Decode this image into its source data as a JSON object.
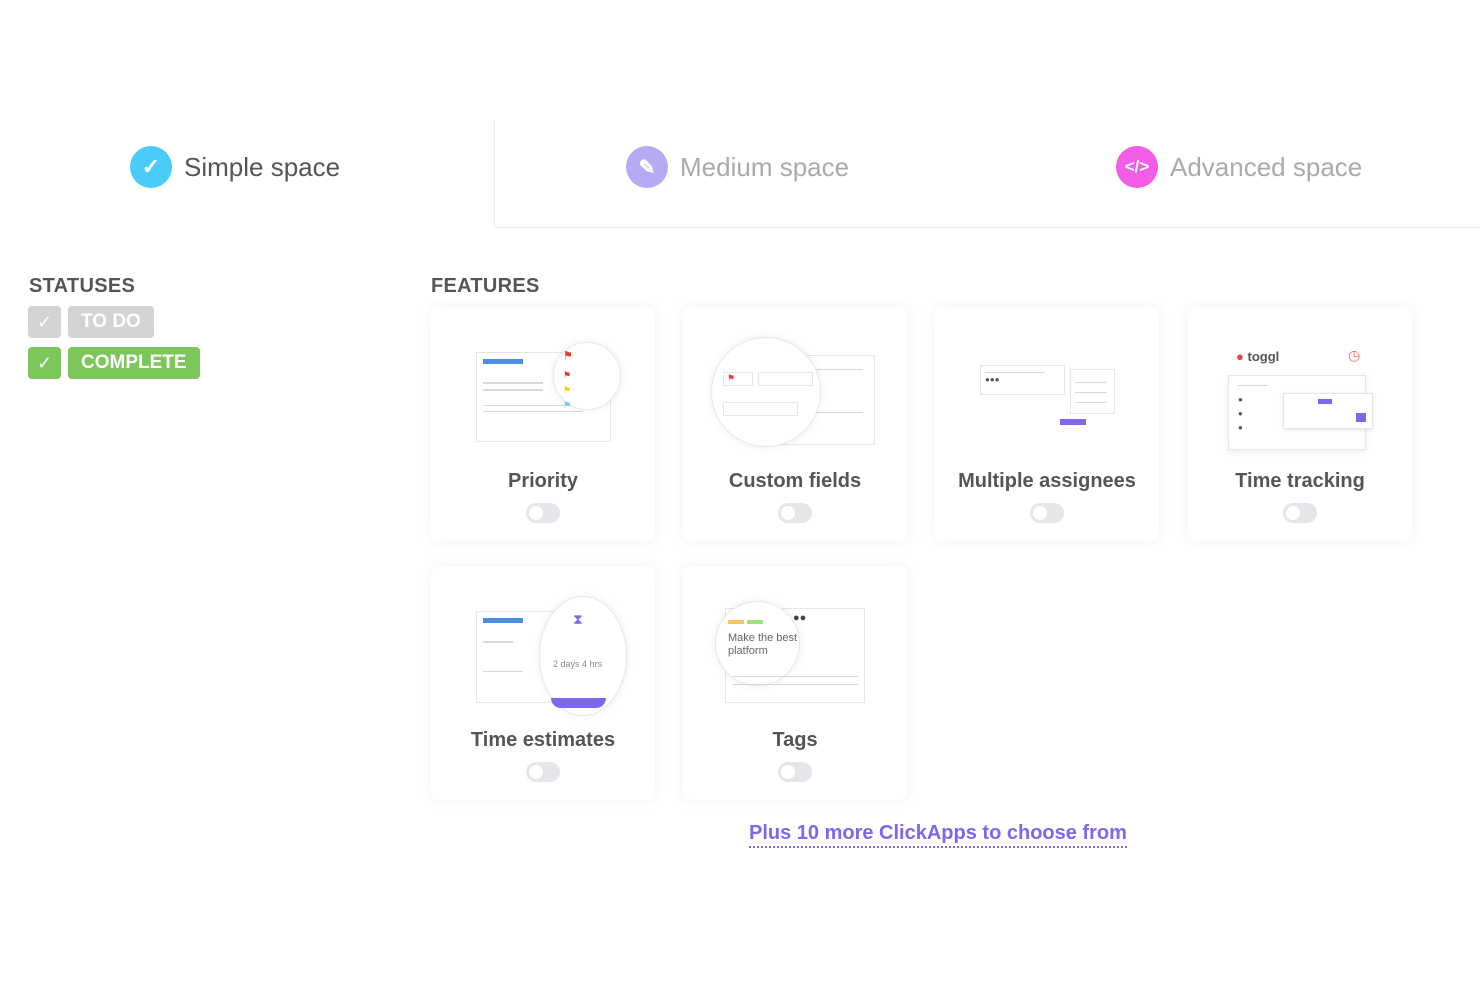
{
  "tabs": [
    {
      "label": "Simple space",
      "icon": "check-circle-icon",
      "color": "#49ccf9",
      "active": true
    },
    {
      "label": "Medium space",
      "icon": "pencil-icon",
      "color": "#b8a9f5",
      "active": false
    },
    {
      "label": "Advanced space",
      "icon": "code-icon",
      "color": "#f35ce6",
      "active": false
    }
  ],
  "statuses": {
    "title": "STATUSES",
    "items": [
      {
        "label": "TO DO",
        "color": "#d3d3d3"
      },
      {
        "label": "COMPLETE",
        "color": "#7dc65a"
      }
    ]
  },
  "features": {
    "title": "FEATURES",
    "items": [
      {
        "label": "Priority",
        "enabled": false
      },
      {
        "label": "Custom fields",
        "enabled": false
      },
      {
        "label": "Multiple assignees",
        "enabled": false
      },
      {
        "label": "Time tracking",
        "enabled": false,
        "illustration_text": "toggl"
      },
      {
        "label": "Time estimates",
        "enabled": false,
        "illustration_text": "2 days 4 hrs"
      },
      {
        "label": "Tags",
        "enabled": false,
        "illustration_text": "Make the best platform"
      }
    ]
  },
  "more_link": "Plus 10 more ClickApps to choose from"
}
